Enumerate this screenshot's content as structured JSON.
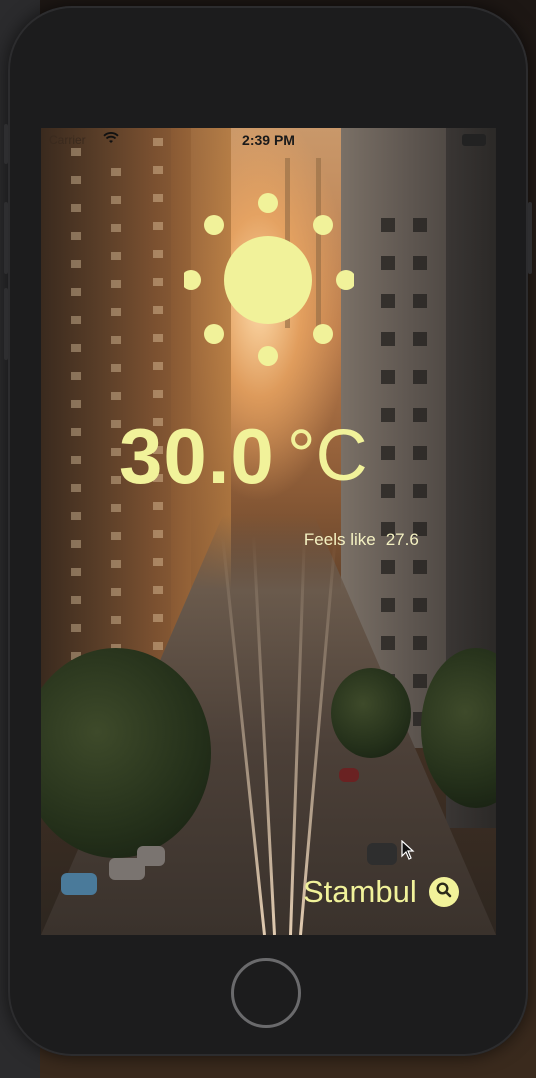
{
  "status_bar": {
    "carrier": "Carrier",
    "time": "2:39 PM"
  },
  "weather": {
    "condition_icon": "sun-icon",
    "temperature": "30.0",
    "unit": "°C",
    "feels_like_label": "Feels like",
    "feels_like_value": "27.6"
  },
  "location": {
    "city": "Stambul",
    "search_icon": "search-icon"
  },
  "colors": {
    "accent": "#f1f29a",
    "device_frame": "#1c1c1d"
  }
}
